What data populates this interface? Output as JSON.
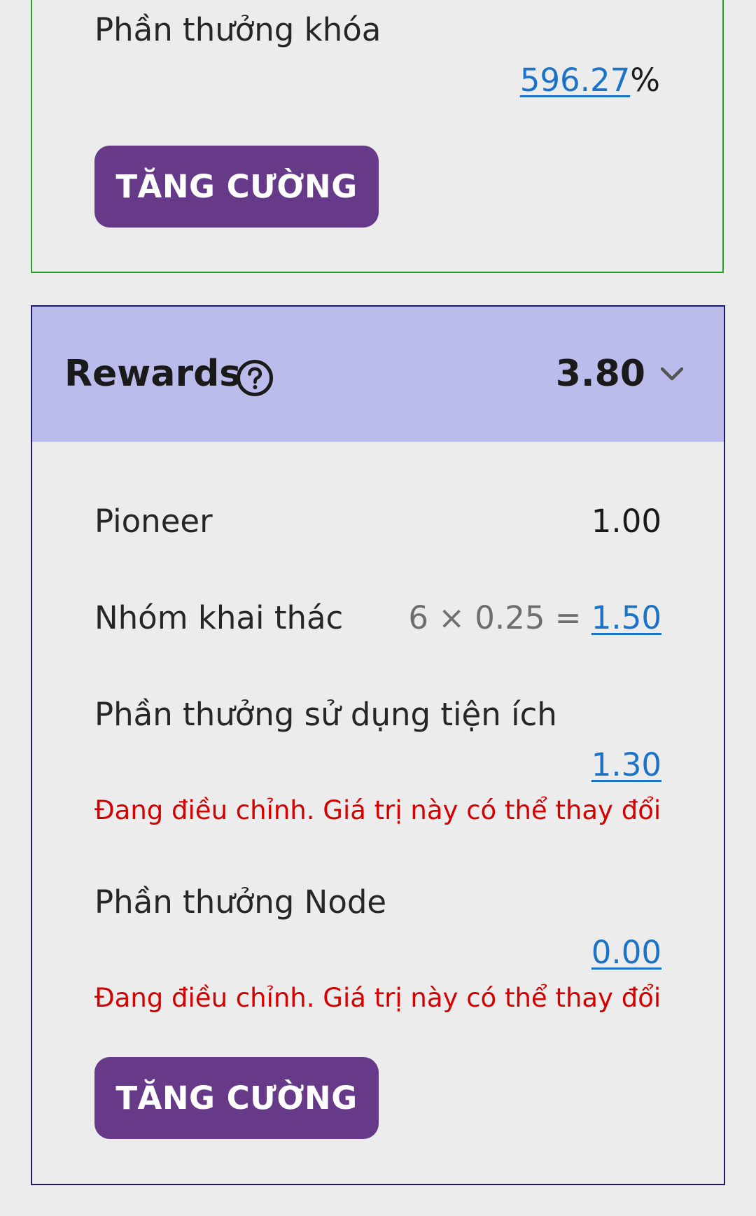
{
  "locked_card": {
    "title": "Phần thưởng khóa",
    "percent_value": "596.27",
    "percent_sign": "%",
    "boost_label": "TĂNG CƯỜNG",
    "border_color": "#22a322"
  },
  "rewards_card": {
    "title": "Rewards",
    "total": "3.80",
    "header_bg": "#bcbcec",
    "icons": {
      "help": "question-circle-icon",
      "expand": "chevron-down-icon"
    },
    "rows": [
      {
        "label": "Pioneer",
        "value": "1.00"
      },
      {
        "label": "Nhóm khai thác",
        "formula": "6 × 0.25 = ",
        "value": "1.50"
      },
      {
        "label": "Phần thưởng sử dụng tiện ích",
        "value": "1.30",
        "warning": "Đang điều chỉnh. Giá trị này có thể thay đổi"
      },
      {
        "label": "Phần thưởng Node",
        "value": "0.00",
        "warning": "Đang điều chỉnh. Giá trị này có thể thay đổi"
      }
    ],
    "boost_label": "TĂNG CƯỜNG"
  },
  "colors": {
    "button": "#663989",
    "link": "#1a73c9",
    "warning": "#d40000",
    "background": "#ececec"
  }
}
